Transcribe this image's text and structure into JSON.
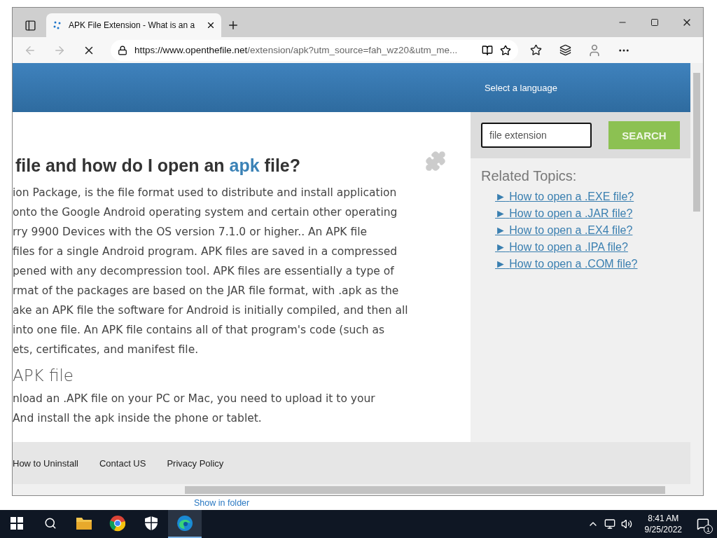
{
  "browser": {
    "tab": {
      "title": "APK File Extension - What is an a",
      "selected": true
    },
    "url": {
      "host": "https://www.openthefile.net",
      "path": "/extension/apk?utm_source=fah_wz20&utm_me..."
    }
  },
  "page": {
    "header": {
      "language_link": "Select a language"
    },
    "article": {
      "heading": {
        "before": "file and how do I open an",
        "highlight": "apk",
        "after": "file?"
      },
      "paragraph_lines": [
        "ion Package, is the file format used to distribute and install application",
        "onto the Google Android operating system and certain other operating",
        "rry 9900 Devices with the OS version 7.1.0 or higher.. An APK file",
        "files for a single Android program. APK files are saved in a compressed",
        "pened with any decompression tool. APK files are essentially a type of",
        "rmat of the packages are based on the JAR file format, with .apk as the",
        "ake an APK file the software for Android is initially compiled, and then all",
        "into one file. An APK file contains all of that program's code (such as",
        "ets, certificates, and manifest file."
      ],
      "subheading": "APK file",
      "paragraph2_lines": [
        "nload an .APK file on your PC or Mac, you need to upload it to your",
        "And install the apk inside the phone or tablet."
      ]
    },
    "sidebar": {
      "search": {
        "value": "file extension",
        "button": "SEARCH"
      },
      "related_title": "Related Topics:",
      "related": [
        {
          "marker": "►",
          "label": "How to open a .EXE file?"
        },
        {
          "marker": "►",
          "label": "How to open a .JAR file?"
        },
        {
          "marker": "►",
          "label": "How to open a .EX4 file?"
        },
        {
          "marker": "►",
          "label": "How to open a .IPA file?"
        },
        {
          "marker": "►",
          "label": "How to open a .COM file?"
        }
      ]
    },
    "footer": [
      "How to Uninstall",
      "Contact US",
      "Privacy Policy"
    ]
  },
  "download_bar": {
    "link": "Show in folder"
  },
  "taskbar": {
    "apps": [
      {
        "kind": "files",
        "selected": false
      },
      {
        "kind": "chrome",
        "selected": false
      },
      {
        "kind": "security",
        "selected": false
      },
      {
        "kind": "edge",
        "selected": true
      }
    ],
    "time": "8:41 AM",
    "date": "9/25/2022",
    "notifications": "1"
  }
}
